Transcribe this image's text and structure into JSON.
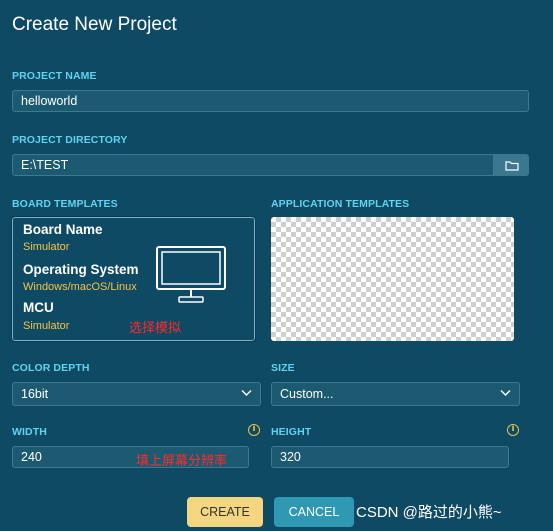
{
  "dialog": {
    "title": "Create New Project"
  },
  "project_name": {
    "label": "PROJECT NAME",
    "value": "helloworld"
  },
  "project_directory": {
    "label": "PROJECT DIRECTORY",
    "value": "E:\\TEST",
    "browse_icon": "folder-icon"
  },
  "board_templates": {
    "label": "BOARD TEMPLATES",
    "card": {
      "board_name_key": "Board Name",
      "board_name_value": "Simulator",
      "os_key": "Operating System",
      "os_value": "Windows/macOS/Linux",
      "mcu_key": "MCU",
      "mcu_value": "Simulator",
      "icon": "monitor-icon",
      "annotation": "选择模拟"
    }
  },
  "application_templates": {
    "label": "APPLICATION TEMPLATES"
  },
  "color_depth": {
    "label": "COLOR DEPTH",
    "selected": "16bit"
  },
  "size": {
    "label": "SIZE",
    "selected": "Custom..."
  },
  "width": {
    "label": "WIDTH",
    "value": "240",
    "annotation": "填上屏幕分辨率"
  },
  "height": {
    "label": "HEIGHT",
    "value": "320"
  },
  "buttons": {
    "create": "CREATE",
    "cancel": "CANCEL"
  },
  "watermark": "CSDN @路过的小熊~",
  "colors": {
    "background": "#0e4a63",
    "label_accent": "#5fd3f0",
    "value_accent": "#f5c34a",
    "create_button": "#f4d680",
    "cancel_button": "#2f98b3",
    "annotation": "#ff2a2a"
  }
}
